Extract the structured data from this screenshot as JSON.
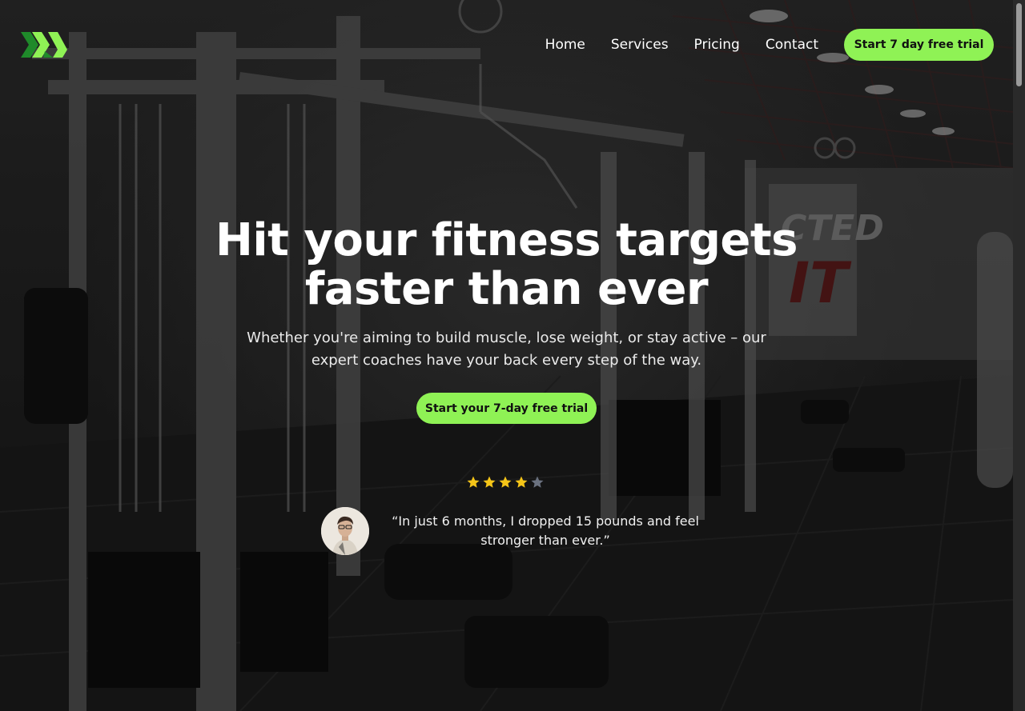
{
  "header": {
    "logo_icon": "brand-chevron-logo",
    "nav": [
      {
        "label": "Home"
      },
      {
        "label": "Services"
      },
      {
        "label": "Pricing"
      },
      {
        "label": "Contact"
      }
    ],
    "cta_label": "Start 7 day free trial"
  },
  "hero": {
    "title_line1": "Hit your fitness targets",
    "title_line2": "faster than ever",
    "subtitle": "Whether you're aiming to build muscle, lose weight, or stay active – our expert coaches have your back every step of the way.",
    "cta_label": "Start your 7-day free trial"
  },
  "testimonial": {
    "rating": 4,
    "rating_max": 5,
    "quote": "“In just 6 months, I dropped 15 pounds and feel stronger than ever.”"
  },
  "colors": {
    "accent": "#8ff255",
    "logo_dark": "#1f8a2a",
    "star_filled": "#f5c518",
    "star_empty": "#6b7280"
  }
}
